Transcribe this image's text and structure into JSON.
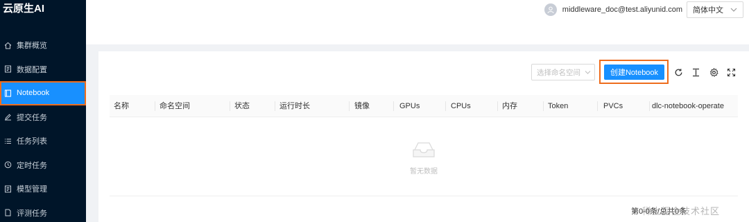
{
  "brand": "云原生AI",
  "sidebar": {
    "items": [
      {
        "label": "集群概览",
        "icon": "home-icon",
        "active": false
      },
      {
        "label": "数据配置",
        "icon": "document-icon",
        "active": false
      },
      {
        "label": "Notebook",
        "icon": "notebook-icon",
        "active": true
      },
      {
        "label": "提交任务",
        "icon": "edit-icon",
        "active": false
      },
      {
        "label": "任务列表",
        "icon": "list-icon",
        "active": false
      },
      {
        "label": "定时任务",
        "icon": "clock-icon",
        "active": false
      },
      {
        "label": "模型管理",
        "icon": "document-icon",
        "active": false
      },
      {
        "label": "评测任务",
        "icon": "file-icon",
        "active": false
      }
    ]
  },
  "header": {
    "user_email": "middleware_doc@test.aliyunid.com",
    "language": "简体中文"
  },
  "toolbar": {
    "namespace_placeholder": "选择命名空间",
    "create_label": "创建Notebook",
    "icons": [
      "refresh-icon",
      "column-height-icon",
      "settings-icon",
      "fullscreen-icon"
    ]
  },
  "table": {
    "columns": [
      "名称",
      "命名空间",
      "状态",
      "运行时长",
      "镜像",
      "GPUs",
      "CPUs",
      "内存",
      "Token",
      "PVCs",
      "dlc-notebook-operate"
    ],
    "rows": [],
    "empty_text": "暂无数据"
  },
  "pagination": {
    "text": "第0-0条/总共0条"
  },
  "watermark": "稀土掘金技术社区",
  "colors": {
    "sidebar_bg": "#001529",
    "accent": "#1890ff",
    "highlight": "#ee6c1c"
  }
}
